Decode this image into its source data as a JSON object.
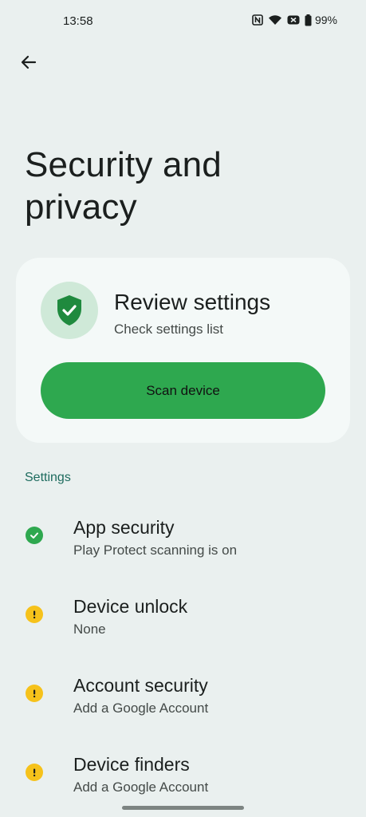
{
  "status": {
    "time": "13:58",
    "battery": "99%",
    "icons": [
      "nfc-icon",
      "wifi-icon",
      "mute-icon",
      "battery-icon"
    ]
  },
  "nav": {
    "back_icon": "arrow-back-icon"
  },
  "page": {
    "title": "Security and privacy"
  },
  "review_card": {
    "icon": "shield-check-icon",
    "title": "Review settings",
    "subtitle": "Check settings list",
    "button_label": "Scan device"
  },
  "settings": {
    "section_label": "Settings",
    "items": [
      {
        "title": "App security",
        "subtitle": "Play Protect scanning is on",
        "status": "ok",
        "icon": "check-circle-icon"
      },
      {
        "title": "Device unlock",
        "subtitle": "None",
        "status": "warning",
        "icon": "warning-circle-icon"
      },
      {
        "title": "Account security",
        "subtitle": "Add a Google Account",
        "status": "warning",
        "icon": "warning-circle-icon"
      },
      {
        "title": "Device finders",
        "subtitle": "Add a Google Account",
        "status": "warning",
        "icon": "warning-circle-icon"
      }
    ]
  },
  "colors": {
    "background": "#eaf0ef",
    "card": "#f4f9f8",
    "accent_green": "#2ea84f",
    "shield_green": "#1f8a3e",
    "warning_yellow": "#f6c21b",
    "section_teal": "#1d6b5e"
  }
}
